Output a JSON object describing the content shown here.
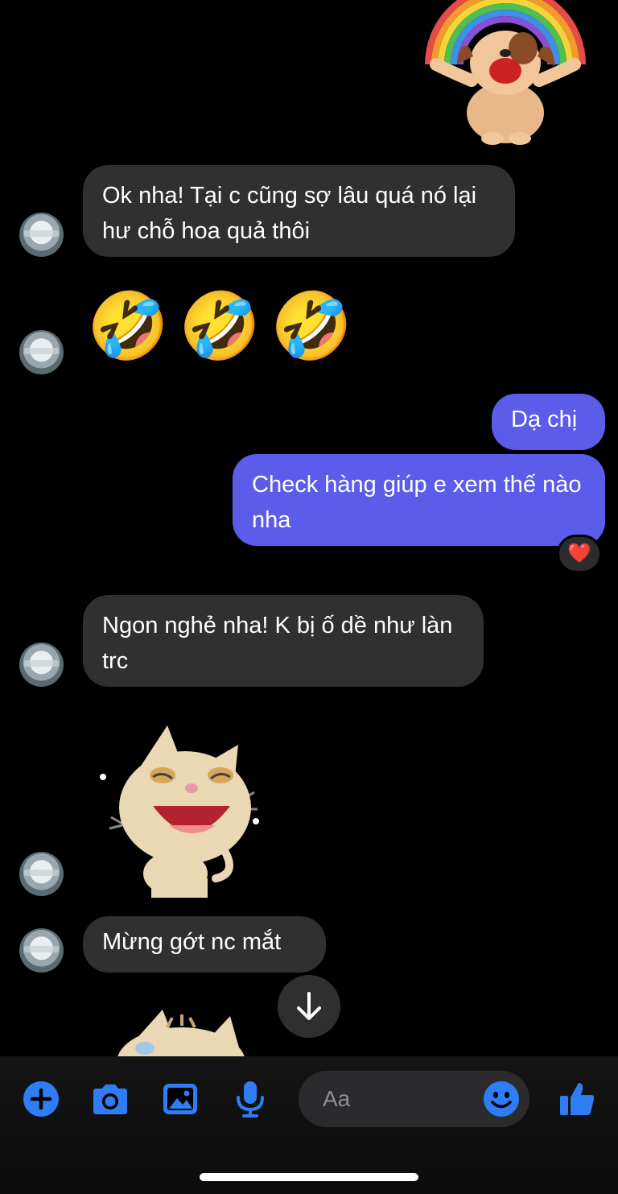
{
  "messages": {
    "m1": {
      "text": "Ok nha! Tại c cũng sợ lâu quá nó lại hư chỗ hoa quả thôi"
    },
    "m2": {
      "emojis": "🤣🤣🤣"
    },
    "m3": {
      "text": "Dạ chị"
    },
    "m4": {
      "text": "Check hàng giúp e xem thế nào nha",
      "reaction": "❤️"
    },
    "m5": {
      "text": "Ngon nghẻ nha! K bị ố dề như làn trc"
    },
    "m6": {
      "text": "Mừng gớt nc mắt"
    }
  },
  "composer": {
    "placeholder": "Aa",
    "accent_color": "#2e7df6",
    "tools": [
      "plus-icon",
      "camera-icon",
      "image-icon",
      "microphone-icon"
    ],
    "emoji_icon": "smiley-icon",
    "send_icon": "thumbs-up-icon"
  },
  "colors": {
    "outgoing_bubble": "#5b5ce9",
    "incoming_bubble": "#303030",
    "background": "#000000"
  }
}
